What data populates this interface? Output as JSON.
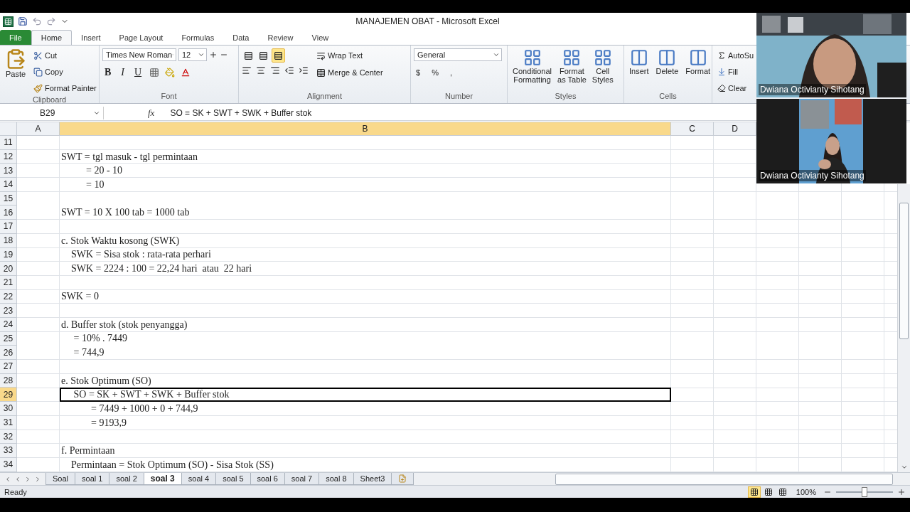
{
  "window": {
    "title": "MANAJEMEN OBAT  -  Microsoft Excel"
  },
  "ribbon_tabs": [
    {
      "label": "File",
      "kind": "file",
      "selected": false
    },
    {
      "label": "Home",
      "kind": "tab",
      "selected": true
    },
    {
      "label": "Insert",
      "kind": "tab",
      "selected": false
    },
    {
      "label": "Page Layout",
      "kind": "tab",
      "selected": false
    },
    {
      "label": "Formulas",
      "kind": "tab",
      "selected": false
    },
    {
      "label": "Data",
      "kind": "tab",
      "selected": false
    },
    {
      "label": "Review",
      "kind": "tab",
      "selected": false
    },
    {
      "label": "View",
      "kind": "tab",
      "selected": false
    }
  ],
  "clipboard": {
    "paste": "Paste",
    "cut": "Cut",
    "copy": "Copy",
    "format_painter": "Format Painter",
    "label": "Clipboard"
  },
  "font": {
    "name": "Times New Roman",
    "size": "12",
    "bold": "B",
    "italic": "I",
    "underline": "U",
    "label": "Font"
  },
  "alignment": {
    "vertical": [
      {
        "selected": false
      },
      {
        "selected": false
      },
      {
        "selected": true
      }
    ],
    "wrap_text": "Wrap Text",
    "merge": "Merge & Center",
    "label": "Alignment"
  },
  "number": {
    "format": "General",
    "currency": "$",
    "percent": "%",
    "comma": ",",
    "label": "Number"
  },
  "styles": {
    "items": [
      [
        "Conditional",
        "Formatting"
      ],
      [
        "Format",
        "as Table"
      ],
      [
        "Cell",
        "Styles"
      ]
    ],
    "label": "Styles"
  },
  "cells": {
    "items": [
      "Insert",
      "Delete",
      "Format"
    ],
    "label": "Cells"
  },
  "editing": {
    "autosum": "AutoSu",
    "fill": "Fill",
    "clear": "Clear"
  },
  "formula_bar": {
    "name_box": "B29",
    "function_symbol": "fx",
    "formula": "SO = SK + SWT + SWK + Buffer stok"
  },
  "columns": [
    {
      "label": "A",
      "selected": false
    },
    {
      "label": "B",
      "selected": true
    },
    {
      "label": "C",
      "selected": false
    },
    {
      "label": "D",
      "selected": false
    }
  ],
  "rows": [
    {
      "number": "11",
      "selected": false
    },
    {
      "number": "12",
      "selected": false,
      "b": "SWT = tgl masuk - tgl permintaan"
    },
    {
      "number": "13",
      "selected": false,
      "b": "          = 20 - 10"
    },
    {
      "number": "14",
      "selected": false,
      "b": "          = 10"
    },
    {
      "number": "15",
      "selected": false
    },
    {
      "number": "16",
      "selected": false,
      "b": "SWT = 10 X 100 tab = 1000 tab"
    },
    {
      "number": "17",
      "selected": false
    },
    {
      "number": "18",
      "selected": false,
      "b": "c. Stok Waktu kosong (SWK)"
    },
    {
      "number": "19",
      "selected": false,
      "b": "    SWK = Sisa stok : rata-rata perhari"
    },
    {
      "number": "20",
      "selected": false,
      "b": "    SWK = 2224 : 100 = 22,24 hari  atau  22 hari"
    },
    {
      "number": "21",
      "selected": false
    },
    {
      "number": "22",
      "selected": false,
      "b": "SWK = 0"
    },
    {
      "number": "23",
      "selected": false
    },
    {
      "number": "24",
      "selected": false,
      "b": "d. Buffer stok (stok penyangga)"
    },
    {
      "number": "25",
      "selected": false,
      "b": "     = 10% . 7449"
    },
    {
      "number": "26",
      "selected": false,
      "b": "     = 744,9"
    },
    {
      "number": "27",
      "selected": false
    },
    {
      "number": "28",
      "selected": false,
      "b": "e. Stok Optimum (SO)"
    },
    {
      "number": "29",
      "selected": true,
      "b": "     SO = SK + SWT + SWK + Buffer stok"
    },
    {
      "number": "30",
      "selected": false,
      "b": "            = 7449 + 1000 + 0 + 744,9"
    },
    {
      "number": "31",
      "selected": false,
      "b": "            = 9193,9"
    },
    {
      "number": "32",
      "selected": false
    },
    {
      "number": "33",
      "selected": false,
      "b": "f. Permintaan"
    },
    {
      "number": "34",
      "selected": false,
      "b": "    Permintaan = Stok Optimum (SO) - Sisa Stok (SS)"
    }
  ],
  "sheet_tabs": [
    {
      "label": "Soal",
      "selected": false
    },
    {
      "label": "soal 1",
      "selected": false
    },
    {
      "label": "soal 2",
      "selected": false
    },
    {
      "label": "soal 3",
      "selected": true
    },
    {
      "label": "soal 4",
      "selected": false
    },
    {
      "label": "soal 5",
      "selected": false
    },
    {
      "label": "soal 6",
      "selected": false
    },
    {
      "label": "soal 7",
      "selected": false
    },
    {
      "label": "soal 8",
      "selected": false
    },
    {
      "label": "Sheet3",
      "selected": false
    }
  ],
  "status_bar": {
    "state": "Ready",
    "views": [
      {
        "selected": true
      },
      {
        "selected": false
      },
      {
        "selected": false
      }
    ],
    "zoom": "100%",
    "zoom_slider": {
      "level": 0.5
    }
  },
  "video_tiles": [
    {
      "kind": "picture",
      "name": "Dwiana Octivianty Sihotang"
    },
    {
      "kind": "picture",
      "name": "Dwiana Octivianty Sihotang"
    }
  ]
}
